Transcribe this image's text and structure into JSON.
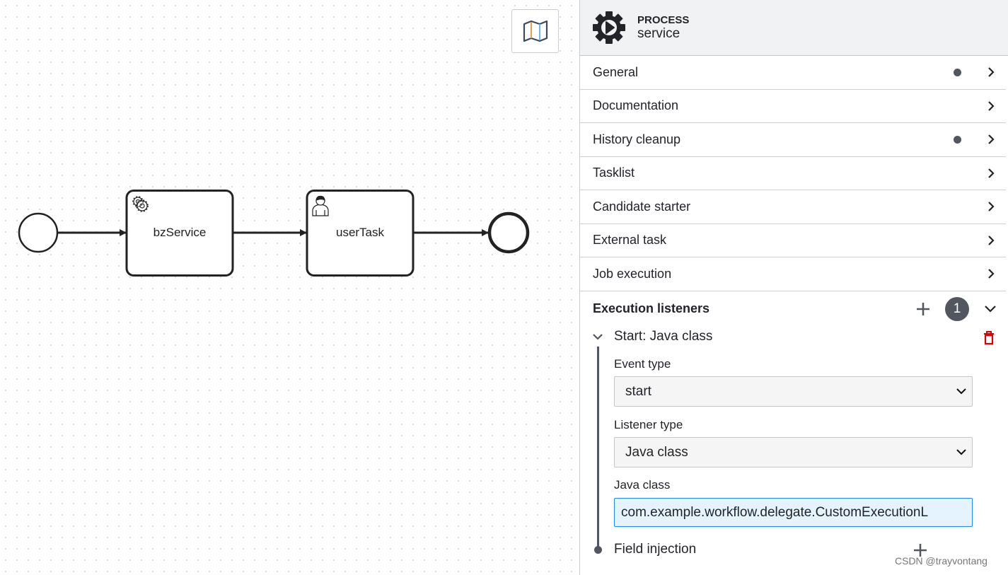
{
  "canvas": {
    "tasks": [
      {
        "label": "bzService",
        "type": "service-task"
      },
      {
        "label": "userTask",
        "type": "user-task"
      }
    ],
    "minimap_icon": "map-icon"
  },
  "panel": {
    "header": {
      "type": "PROCESS",
      "name": "service",
      "icon": "process-gear-play-icon"
    },
    "groups": [
      {
        "label": "General",
        "has_dot": true
      },
      {
        "label": "Documentation",
        "has_dot": false
      },
      {
        "label": "History cleanup",
        "has_dot": true
      },
      {
        "label": "Tasklist",
        "has_dot": false
      },
      {
        "label": "Candidate starter",
        "has_dot": false
      },
      {
        "label": "External task",
        "has_dot": false
      },
      {
        "label": "Job execution",
        "has_dot": false
      }
    ],
    "execution_listeners": {
      "label": "Execution listeners",
      "count": "1",
      "item": {
        "title": "Start: Java class",
        "event_type_label": "Event type",
        "event_type_value": "start",
        "listener_type_label": "Listener type",
        "listener_type_value": "Java class",
        "java_class_label": "Java class",
        "java_class_value": "com.example.workflow.delegate.CustomExecutionL",
        "field_injection_label": "Field injection"
      }
    },
    "colors": {
      "delete": "#e00000",
      "badge": "#52565e",
      "input_focus": "#1a8df2"
    }
  },
  "watermark": "CSDN @trayvontang"
}
